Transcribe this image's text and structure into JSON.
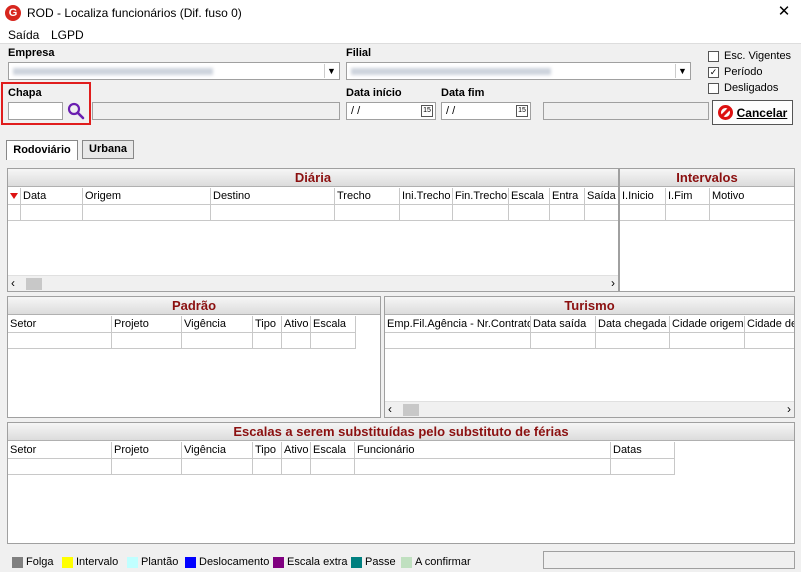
{
  "window": {
    "title": "ROD - Localiza funcionários (Dif. fuso 0)",
    "logo_letter": "G",
    "close_label": "✕"
  },
  "menu": [
    {
      "label": "Saída"
    },
    {
      "label": "LGPD"
    }
  ],
  "filters": {
    "empresa_label": "Empresa",
    "filial_label": "Filial",
    "chapa_label": "Chapa",
    "chapa_value": "",
    "data_inicio_label": "Data início",
    "data_inicio_value": " /  /",
    "data_fim_label": "Data fim",
    "data_fim_value": " /  /",
    "checkboxes": [
      {
        "label": "Esc. Vigentes",
        "checked": false
      },
      {
        "label": "Período",
        "checked": true
      },
      {
        "label": "Desligados",
        "checked": false
      }
    ],
    "cancel_label": "Cancelar"
  },
  "tabs": [
    {
      "label": "Rodoviário",
      "active": true
    },
    {
      "label": "Urbana",
      "active": false
    }
  ],
  "panels": {
    "diaria": {
      "title": "Diária",
      "columns": [
        "Data",
        "Origem",
        "Destino",
        "Trecho",
        "Ini.Trecho",
        "Fin.Trecho",
        "Escala",
        "Entra",
        "Saída"
      ]
    },
    "intervalos": {
      "title": "Intervalos",
      "columns": [
        "I.Inicio",
        "I.Fim",
        "Motivo"
      ]
    },
    "padrao": {
      "title": "Padrão",
      "columns": [
        "Setor",
        "Projeto",
        "Vigência",
        "Tipo",
        "Ativo",
        "Escala"
      ]
    },
    "turismo": {
      "title": "Turismo",
      "columns": [
        "Emp.Fil.Agência - Nr.Contrato",
        "Data saída",
        "Data chegada",
        "Cidade origem",
        "Cidade de"
      ]
    },
    "escalas": {
      "title": "Escalas a serem substituídas pelo substituto de férias",
      "columns": [
        "Setor",
        "Projeto",
        "Vigência",
        "Tipo",
        "Ativo",
        "Escala",
        "Funcionário",
        "Datas"
      ]
    }
  },
  "legend": [
    {
      "label": "Folga",
      "color": "#808080"
    },
    {
      "label": "Intervalo",
      "color": "#ffff00"
    },
    {
      "label": "Plantão",
      "color": "#c0ffff"
    },
    {
      "label": "Deslocamento",
      "color": "#0000ff"
    },
    {
      "label": "Escala extra",
      "color": "#800080"
    },
    {
      "label": "Passe",
      "color": "#008080"
    },
    {
      "label": "A confirmar",
      "color": "#c0e0c0"
    }
  ]
}
